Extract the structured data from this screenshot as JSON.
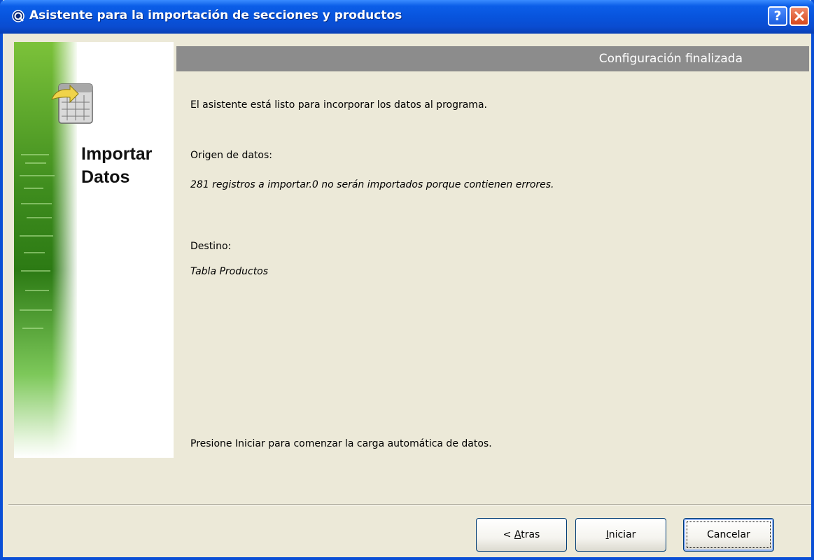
{
  "window": {
    "title": "Asistente para la importación de secciones y productos",
    "help_label": "?"
  },
  "side_panel": {
    "title_line1": "Importar",
    "title_line2": "Datos"
  },
  "header": {
    "title": "Configuración finalizada"
  },
  "content": {
    "intro": "El asistente está listo para incorporar los datos al programa.",
    "source_label": "Origen de datos:",
    "source_value": "281 registros a importar.0 no serán importados porque contienen errores.",
    "dest_label": "Destino:",
    "dest_value": "Tabla Productos",
    "footer_hint": "Presione Iniciar para comenzar la carga automática de datos."
  },
  "buttons": {
    "back_prefix": "< ",
    "back_accel": "A",
    "back_rest": "tras",
    "start_accel": "I",
    "start_rest": "niciar",
    "cancel": "Cancelar"
  },
  "colors": {
    "titlebar": "#0854dd",
    "header_bar": "#8c8c8c",
    "dialog_bg": "#ece9d8"
  }
}
